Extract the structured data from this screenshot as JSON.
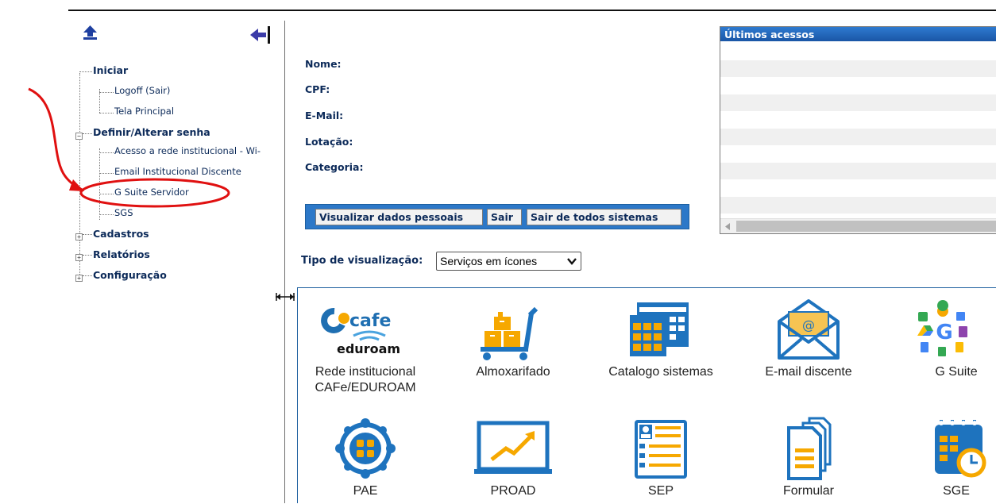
{
  "sidebar": {
    "tree": [
      {
        "label": "Iniciar",
        "level": 1
      },
      {
        "label": "Logoff (Sair)",
        "level": 2
      },
      {
        "label": "Tela Principal",
        "level": 2
      },
      {
        "label": "Definir/Alterar senha",
        "level": 1,
        "toggle": "−"
      },
      {
        "label": "Acesso a rede institucional - Wi-",
        "level": 2
      },
      {
        "label": "Email Institucional Discente",
        "level": 2
      },
      {
        "label": "G Suite Servidor",
        "level": 2,
        "highlighted": true
      },
      {
        "label": "SGS",
        "level": 2
      },
      {
        "label": "Cadastros",
        "level": 1,
        "toggle": "+"
      },
      {
        "label": "Relatórios",
        "level": 1,
        "toggle": "+"
      },
      {
        "label": "Configuração",
        "level": 1,
        "toggle": "+"
      }
    ],
    "icons": {
      "up": "upload-arrow-icon",
      "collapse": "collapse-left-icon",
      "resize": "resize-horizontal-icon"
    }
  },
  "profile": {
    "nome_label": "Nome:",
    "cpf_label": "CPF:",
    "email_label": "E-Mail:",
    "lotacao_label": "Lotação:",
    "categoria_label": "Categoria:"
  },
  "buttons": {
    "view_personal": "Visualizar dados pessoais",
    "exit": "Sair",
    "exit_all": "Sair de todos sistemas"
  },
  "view_mode": {
    "label": "Tipo de visualização:",
    "selected": "Serviços em ícones"
  },
  "recent_access": {
    "title": "Últimos acessos"
  },
  "services": [
    {
      "label": "Rede institucional CAFe/EDUROAM",
      "label_line1": "Rede institucional",
      "label_line2": "CAFe/EDUROAM",
      "icon": "cafe-eduroam-logo",
      "logo_text1": "cafe",
      "logo_text2": "eduroam"
    },
    {
      "label": "Almoxarifado",
      "icon": "warehouse-cart-icon"
    },
    {
      "label": "Catalogo sistemas",
      "icon": "calendar-grid-icon"
    },
    {
      "label": "E-mail discente",
      "icon": "email-envelope-icon"
    },
    {
      "label": "G Suite",
      "icon": "gsuite-apps-icon"
    },
    {
      "label": "PAE",
      "icon": "pae-network-icon"
    },
    {
      "label": "PROAD",
      "icon": "chart-monitor-icon"
    },
    {
      "label": "SEP",
      "icon": "checklist-icon"
    },
    {
      "label": "Formular",
      "icon": "documents-icon"
    },
    {
      "label": "SGE",
      "icon": "calendar-clock-icon"
    }
  ],
  "colors": {
    "accent_blue": "#2c78c8",
    "text_navy": "#0c2a59",
    "icon_blue": "#1e73be",
    "icon_orange": "#f6a800",
    "annotation_red": "#e01010"
  }
}
